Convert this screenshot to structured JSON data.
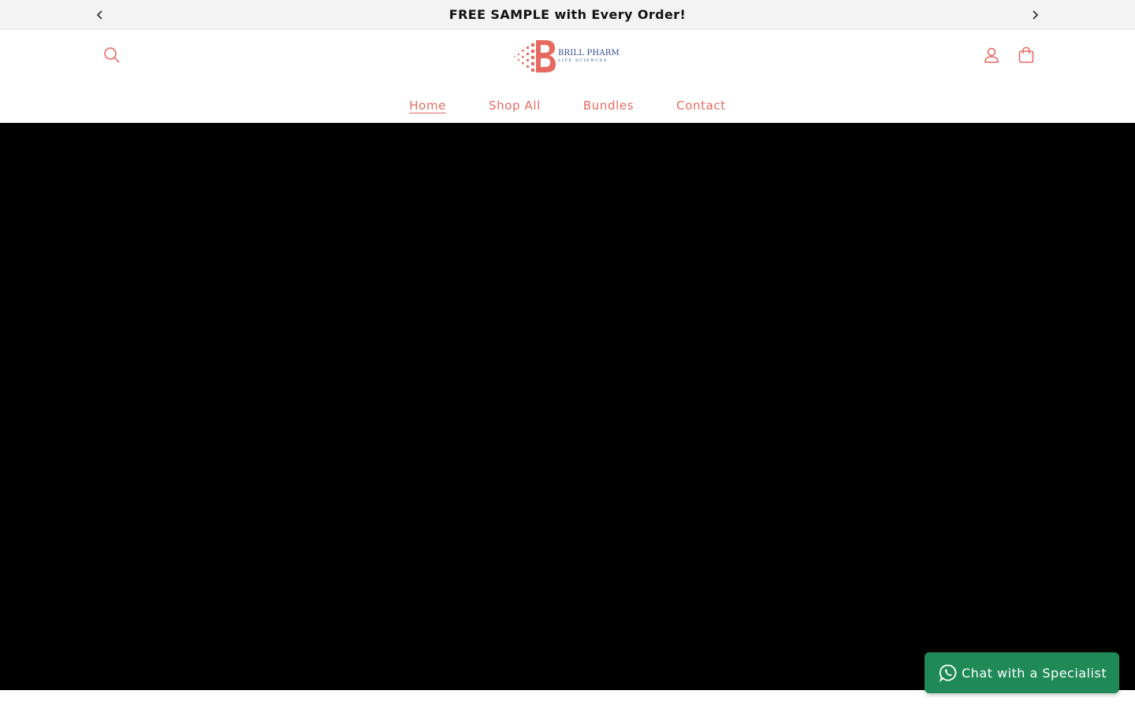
{
  "announcement": {
    "text": "FREE SAMPLE with Every Order!",
    "prev_icon": "chevron-left-icon",
    "next_icon": "chevron-right-icon"
  },
  "header": {
    "logo": {
      "name": "BRILL PHARM",
      "tagline": "LIFE SCIENCES"
    },
    "search_icon": "search-icon",
    "account_icon": "account-icon",
    "cart_icon": "cart-icon"
  },
  "nav": {
    "items": [
      {
        "label": "Home",
        "active": true
      },
      {
        "label": "Shop All",
        "active": false
      },
      {
        "label": "Bundles",
        "active": false
      },
      {
        "label": "Contact",
        "active": false
      }
    ]
  },
  "chat": {
    "label": "Chat with a Specialist",
    "icon": "whatsapp-icon"
  },
  "colors": {
    "brand_coral": "#e76a61",
    "brand_navy": "#2f4b8f",
    "announce_bg": "#f3f3f3",
    "hero_bg": "#000000",
    "chat_green": "#1f8a57"
  }
}
